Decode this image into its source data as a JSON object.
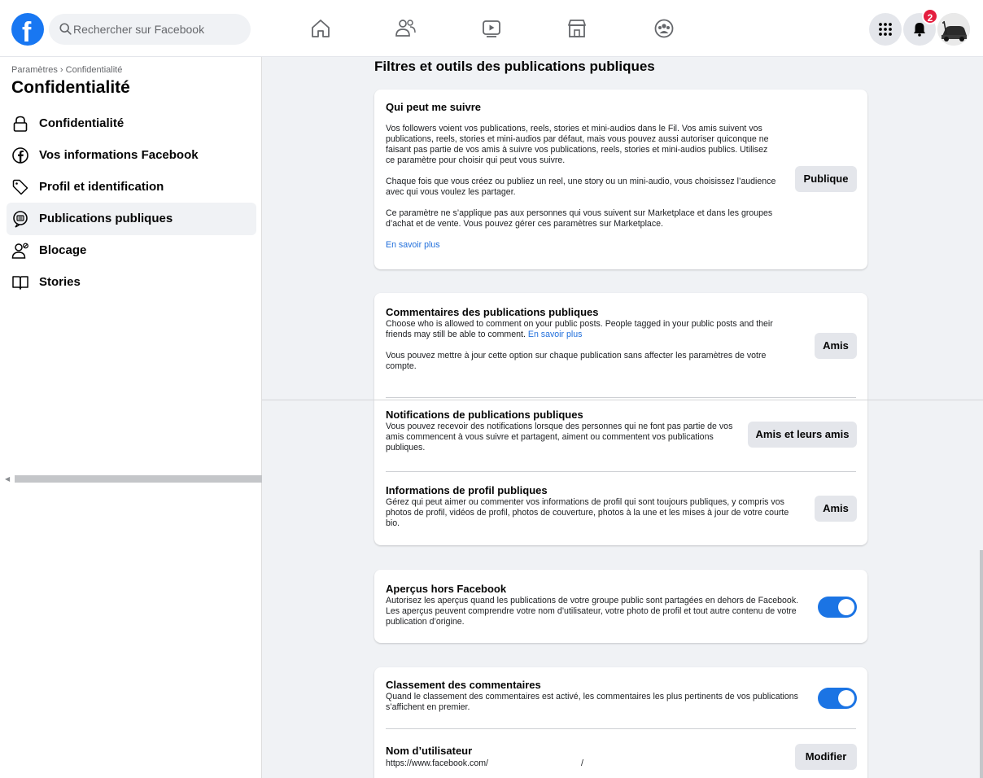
{
  "header": {
    "logo_letter": "f",
    "search_placeholder": "Rechercher sur Facebook",
    "nav_icons": [
      "home-icon",
      "friends-icon",
      "watch-icon",
      "marketplace-icon",
      "groups-icon"
    ],
    "notification_count": "2"
  },
  "sidebar": {
    "breadcrumb": "Paramètres › Confidentialité",
    "title": "Confidentialité",
    "items": [
      {
        "label": "Confidentialité",
        "icon": "lock-icon"
      },
      {
        "label": "Vos informations Facebook",
        "icon": "facebook-circle-icon"
      },
      {
        "label": "Profil et identification",
        "icon": "tag-icon"
      },
      {
        "label": "Publications publiques",
        "icon": "public-posts-icon",
        "active": true
      },
      {
        "label": "Blocage",
        "icon": "block-user-icon"
      },
      {
        "label": "Stories",
        "icon": "book-icon"
      }
    ]
  },
  "main": {
    "title": "Filtres et outils des publications publiques",
    "follow": {
      "title": "Qui peut me suivre",
      "p1": "Vos followers voient vos publications, reels, stories et mini-audios dans le Fil. Vos amis suivent vos publications, reels, stories et mini-audios par défaut, mais vous pouvez aussi autoriser quiconque ne faisant pas partie de vos amis à suivre vos publications, reels, stories et mini-audios publics. Utilisez ce paramètre pour choisir qui peut vous suivre.",
      "p2": "Chaque fois que vous créez ou publiez un reel, une story ou un mini-audio, vous choisissez l’audience avec qui vous voulez les partager.",
      "p3": "Ce paramètre ne s’applique pas aux personnes qui vous suivent sur Marketplace et dans les groupes d’achat et de vente. Vous pouvez gérer ces paramètres sur Marketplace.",
      "link": "En savoir plus",
      "button": "Publique"
    },
    "comments": {
      "title": "Commentaires des publications publiques",
      "p1": "Choose who is allowed to comment on your public posts. People tagged in your public posts and their friends may still be able to comment.",
      "link": "En savoir plus",
      "p2": "Vous pouvez mettre à jour cette option sur chaque publication sans affecter les paramètres de votre compte.",
      "button": "Amis"
    },
    "notifications": {
      "title": "Notifications de publications publiques",
      "p1": "Vous pouvez recevoir des notifications lorsque des personnes qui ne font pas partie de vos amis commencent à vous suivre et partagent, aiment ou commentent vos publications publiques.",
      "button": "Amis et leurs amis"
    },
    "profile_info": {
      "title": "Informations de profil publiques",
      "p1": "Gérez qui peut aimer ou commenter vos informations de profil qui sont toujours publiques, y compris vos photos de profil, vidéos de profil, photos de couverture, photos à la une et les mises à jour de votre courte bio.",
      "button": "Amis"
    },
    "previews": {
      "title": "Aperçus hors Facebook",
      "p1": "Autorisez les aperçus quand les publications de votre groupe public sont partagées en dehors de Facebook. Les aperçus peuvent comprendre votre nom d’utilisateur, votre photo de profil et tout autre contenu de votre publication d’origine.",
      "toggle_on": true
    },
    "ranking": {
      "title": "Classement des commentaires",
      "p1": "Quand le classement des commentaires est activé, les commentaires les plus pertinents de vos publications s’affichent en premier.",
      "toggle_on": true
    },
    "username": {
      "title": "Nom d’utilisateur",
      "url": "https://www.facebook.com/",
      "slash": "/",
      "button": "Modifier"
    }
  },
  "colors": {
    "accent": "#1877f2",
    "toggle": "#1b74e4",
    "link": "#216fdb",
    "badge": "#e41e3f"
  }
}
